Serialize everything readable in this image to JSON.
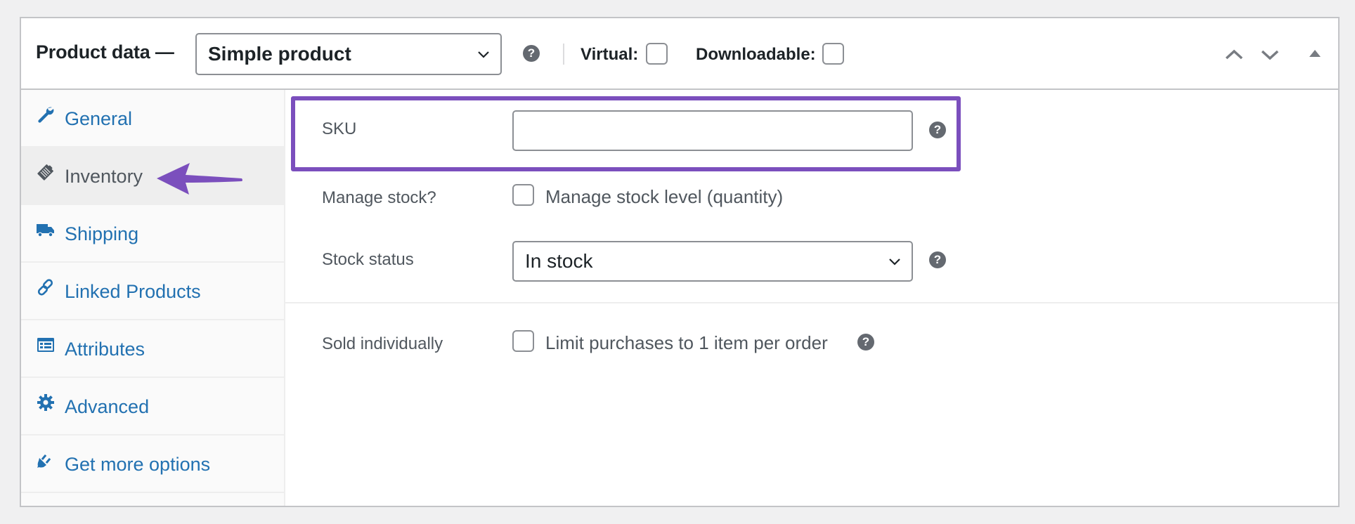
{
  "header": {
    "title": "Product data —",
    "product_type": {
      "selected": "Simple product"
    },
    "help_icon": "?",
    "virtual_label": "Virtual:",
    "virtual_checked": false,
    "downloadable_label": "Downloadable:",
    "downloadable_checked": false,
    "controls": [
      "move-up-icon",
      "move-down-icon",
      "toggle-panel-icon"
    ]
  },
  "sidebar": {
    "active": "Inventory",
    "items": [
      {
        "label": "General",
        "icon": "wrench-icon"
      },
      {
        "label": "Inventory",
        "icon": "clipboard-tag-icon"
      },
      {
        "label": "Shipping",
        "icon": "truck-icon"
      },
      {
        "label": "Linked Products",
        "icon": "link-icon"
      },
      {
        "label": "Attributes",
        "icon": "list-card-icon"
      },
      {
        "label": "Advanced",
        "icon": "gear-icon"
      },
      {
        "label": "Get more options",
        "icon": "plug-icon"
      }
    ]
  },
  "inventory": {
    "sku": {
      "label": "SKU",
      "value": "",
      "help": "?"
    },
    "manage_stock": {
      "label": "Manage stock?",
      "checkbox_label": "Manage stock level (quantity)",
      "checked": false
    },
    "stock_status": {
      "label": "Stock status",
      "selected": "In stock",
      "help": "?"
    },
    "sold_individually": {
      "label": "Sold individually",
      "checkbox_label": "Limit purchases to 1 item per order",
      "checked": false,
      "help": "?"
    }
  },
  "annotation": {
    "highlight_color": "#7b4fbd",
    "highlight_target": "SKU",
    "arrow_target": "Inventory"
  },
  "colors": {
    "link": "#2271b1",
    "active_tab_bg": "#eeeeee",
    "text": "#1d2327",
    "muted": "#50575e"
  }
}
